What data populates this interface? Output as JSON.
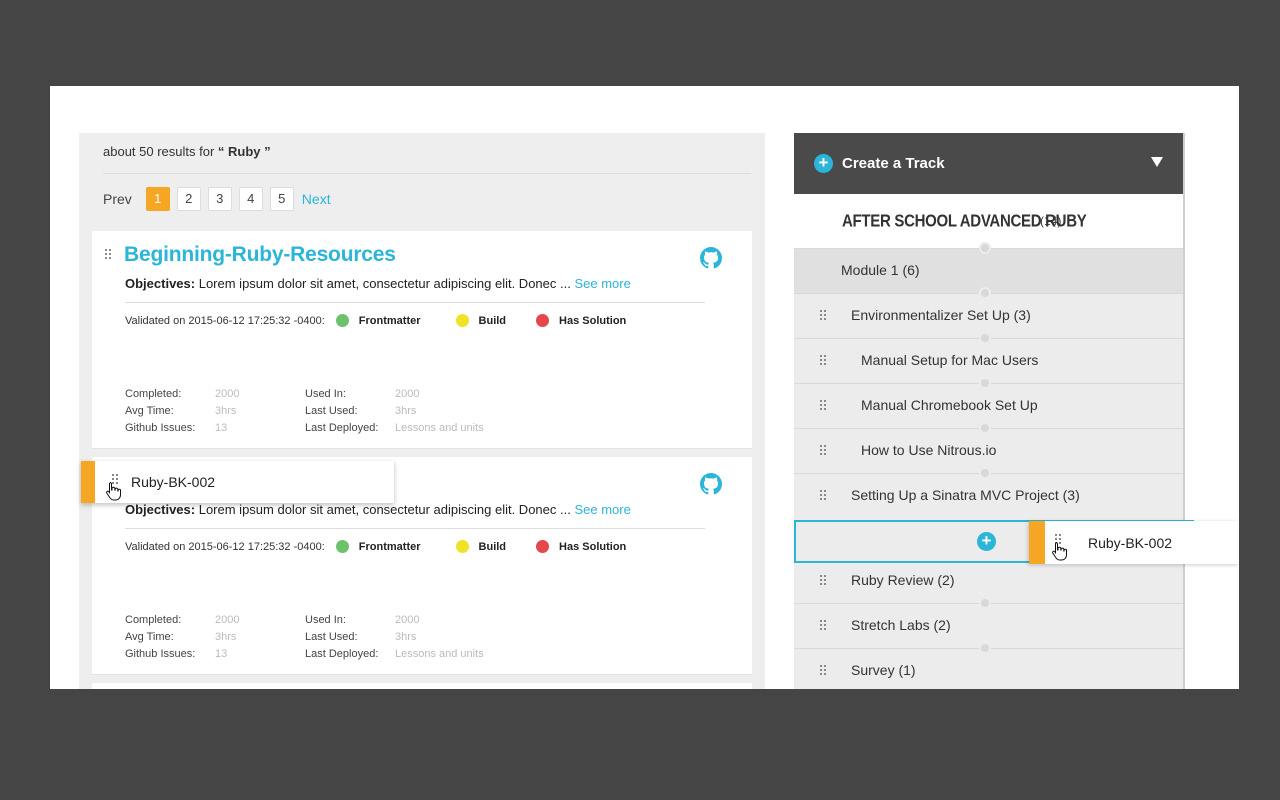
{
  "search": {
    "results_prefix": "about 50 results for",
    "query": "“ Ruby ”"
  },
  "pagination": {
    "prev": "Prev",
    "pages": [
      "1",
      "2",
      "3",
      "4",
      "5"
    ],
    "active_page": "1",
    "next": "Next"
  },
  "cards": [
    {
      "title": "Beginning-Ruby-Resources",
      "objectives_label": "Objectives:",
      "objectives_text": "Lorem ipsum dolor sit amet, consectetur adipiscing elit. Donec ...",
      "see_more": "See more",
      "validated": "Validated on 2015-06-12 17:25:32 -0400:",
      "checks": [
        "Frontmatter",
        "Build",
        "Has Solution"
      ],
      "stats": {
        "completed_label": "Completed:",
        "completed": "2000",
        "avg_time_label": "Avg Time:",
        "avg_time": "3hrs",
        "issues_label": "Github Issues:",
        "issues": "13",
        "used_in_label": "Used In:",
        "used_in": "2000",
        "last_used_label": "Last Used:",
        "last_used": "3hrs",
        "last_deployed_label": "Last Deployed:",
        "last_deployed": "Lessons and units"
      }
    },
    {
      "title": "Ruby-BK-002",
      "objectives_label": "Objectives:",
      "objectives_text": "Lorem ipsum dolor sit amet, consectetur adipiscing elit. Donec ...",
      "see_more": "See more",
      "validated": "Validated on 2015-06-12 17:25:32 -0400:",
      "checks": [
        "Frontmatter",
        "Build",
        "Has Solution"
      ],
      "stats": {
        "completed_label": "Completed:",
        "completed": "2000",
        "avg_time_label": "Avg Time:",
        "avg_time": "3hrs",
        "issues_label": "Github Issues:",
        "issues": "13",
        "used_in_label": "Used In:",
        "used_in": "2000",
        "last_used_label": "Last Used:",
        "last_used": "3hrs",
        "last_deployed_label": "Last Deployed:",
        "last_deployed": "Lessons and units"
      }
    }
  ],
  "check_colors": [
    "#6cc26a",
    "#f0e325",
    "#e5474b"
  ],
  "dragging_item": "Ruby-BK-002",
  "track": {
    "header": "Create a Track",
    "name": "AFTER SCHOOL ADVANCED RUBY",
    "count": "(14)",
    "rows": [
      {
        "label": "Module 1 (6)"
      },
      {
        "label": "Environmentalizer Set Up (3)"
      },
      {
        "label": "Manual Setup for Mac Users"
      },
      {
        "label": "Manual Chromebook Set Up"
      },
      {
        "label": "How to Use Nitrous.io"
      },
      {
        "label": "Setting Up a Sinatra MVC Project (3)"
      },
      {
        "label": "Ruby Review (2)"
      },
      {
        "label": "Stretch Labs (2)"
      },
      {
        "label": "Survey (1)"
      }
    ],
    "drop_item": "Ruby-BK-002"
  },
  "colors": {
    "accent": "#2bb5d9",
    "orange": "#f5a623",
    "header_bg": "#4a4a4a"
  }
}
